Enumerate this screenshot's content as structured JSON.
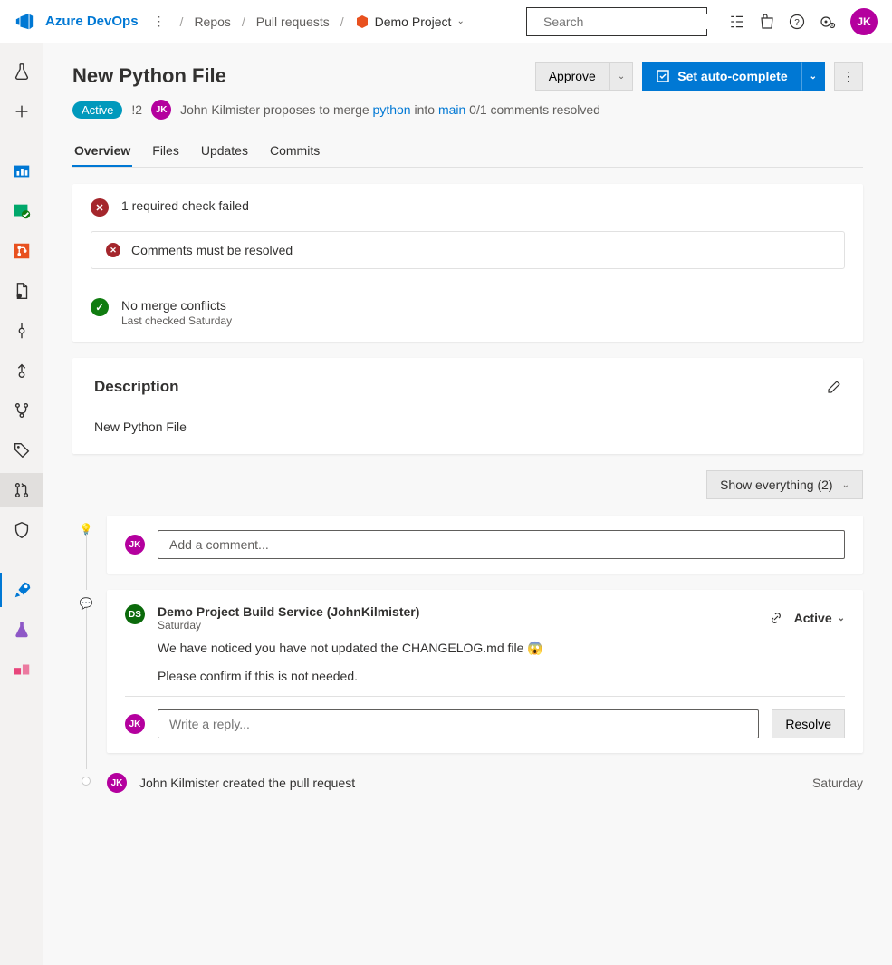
{
  "brand": "Azure DevOps",
  "breadcrumb": {
    "repos": "Repos",
    "pulls": "Pull requests",
    "project": "Demo Project"
  },
  "search": {
    "placeholder": "Search"
  },
  "user_initials": "JK",
  "page": {
    "title": "New Python File",
    "approve": "Approve",
    "autocomplete": "Set auto-complete",
    "status_badge": "Active",
    "pr_id": "!2",
    "author": "John Kilmister",
    "proposes": " proposes to merge ",
    "src_branch": "python",
    "into": " into ",
    "dst_branch": "main",
    "comments_resolved": " 0/1 comments resolved"
  },
  "tabs": {
    "overview": "Overview",
    "files": "Files",
    "updates": "Updates",
    "commits": "Commits"
  },
  "checks": {
    "failed": "1 required check failed",
    "must_resolve": "Comments must be resolved",
    "no_conflicts": "No merge conflicts",
    "last_checked": "Last checked Saturday"
  },
  "description": {
    "label": "Description",
    "body": "New Python File"
  },
  "show_everything": "Show everything (2)",
  "add_comment_placeholder": "Add a comment...",
  "comment": {
    "author": "Demo Project Build Service (JohnKilmister)",
    "time": "Saturday",
    "body1": "We have noticed you have not updated the CHANGELOG.md file 😱",
    "body2": "Please confirm if this is not needed.",
    "status": "Active"
  },
  "reply_placeholder": "Write a reply...",
  "resolve": "Resolve",
  "history": {
    "text": "John Kilmister created the pull request",
    "time": "Saturday"
  }
}
